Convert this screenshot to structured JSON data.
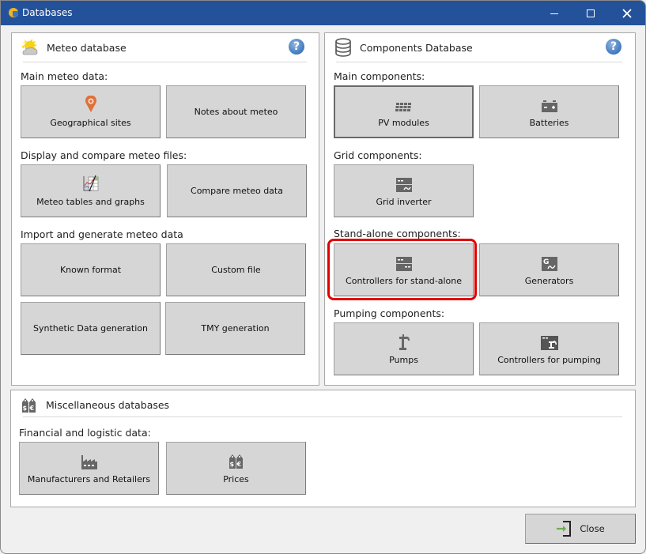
{
  "window": {
    "title": "Databases",
    "controls": {
      "minimize": "minimize",
      "maximize": "maximize",
      "close": "close"
    }
  },
  "meteo": {
    "title": "Meteo database",
    "icon": "sun-cloud-icon",
    "help": "?",
    "sections": [
      {
        "label": "Main meteo data:"
      },
      {
        "label": "Display and compare meteo files:"
      },
      {
        "label": "Import and generate meteo data"
      }
    ],
    "buttons": [
      {
        "label": "Geographical sites",
        "icon": "map-pin-icon"
      },
      {
        "label": "Notes about meteo",
        "icon": ""
      },
      {
        "label": "Meteo tables and graphs",
        "icon": "table-graph-icon"
      },
      {
        "label": "Compare meteo data",
        "icon": ""
      },
      {
        "label": "Known format",
        "icon": ""
      },
      {
        "label": "Custom file",
        "icon": ""
      },
      {
        "label": "Synthetic Data generation",
        "icon": ""
      },
      {
        "label": "TMY generation",
        "icon": ""
      }
    ]
  },
  "components": {
    "title": "Components Database",
    "icon": "database-icon",
    "help": "?",
    "sections": [
      {
        "label": "Main components:"
      },
      {
        "label": "Grid components:"
      },
      {
        "label": "Stand-alone components:"
      },
      {
        "label": "Pumping components:"
      }
    ],
    "buttons": [
      {
        "label": "PV modules",
        "icon": "pv-module-icon",
        "focused": true
      },
      {
        "label": "Batteries",
        "icon": "battery-icon"
      },
      {
        "label": "Grid inverter",
        "icon": "inverter-icon"
      },
      {
        "label": "Controllers for stand-alone",
        "icon": "controller-icon",
        "highlighted": true
      },
      {
        "label": "Generators",
        "icon": "generator-icon"
      },
      {
        "label": "Pumps",
        "icon": "pump-icon"
      },
      {
        "label": "Controllers for pumping",
        "icon": "pump-controller-icon"
      }
    ],
    "highlight_color": "#e00000"
  },
  "misc": {
    "title": "Miscellaneous databases",
    "icon": "price-tags-icon",
    "sections": [
      {
        "label": "Financial and logistic data:"
      }
    ],
    "buttons": [
      {
        "label": "Manufacturers and Retailers",
        "icon": "factory-icon"
      },
      {
        "label": "Prices",
        "icon": "price-tags-icon"
      }
    ]
  },
  "footer": {
    "close_label": "Close",
    "close_icon": "exit-arrow-icon"
  },
  "colors": {
    "titlebar": "#24529a",
    "button": "#d6d6d6",
    "help": "#3f78bd",
    "accent_orange": "#e0703a",
    "arrow_green": "#6ab04c"
  }
}
